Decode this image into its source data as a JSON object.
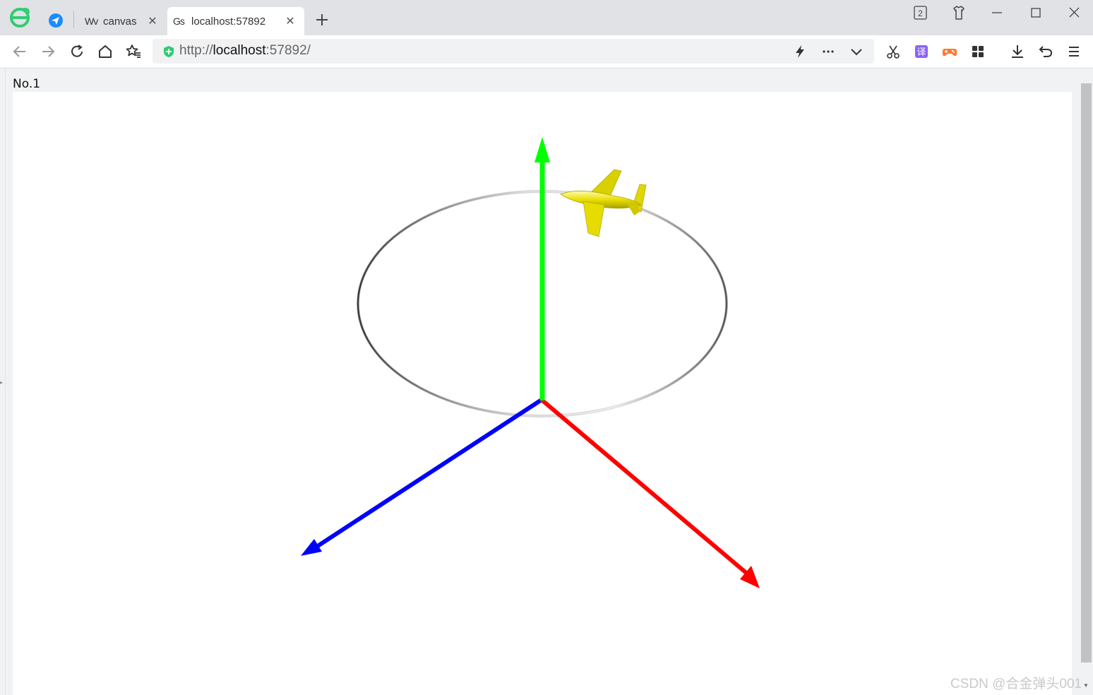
{
  "tabs": [
    {
      "favicon": "Wv",
      "label": "canvas",
      "active": false
    },
    {
      "favicon": "Gs",
      "label": "localhost:57892",
      "active": true
    }
  ],
  "window": {
    "tab_count": "2"
  },
  "address_bar": {
    "url_prefix": "http://",
    "url_host": "localhost",
    "url_suffix": ":57892/"
  },
  "extensions": {
    "translate_label": "译"
  },
  "page": {
    "label": "No.1",
    "watermark": "CSDN @合金弹头001"
  },
  "scene": {
    "objects": [
      "green-y-axis-arrow",
      "red-x-axis-arrow",
      "blue-z-axis-arrow",
      "circular-flight-path",
      "yellow-airplane"
    ],
    "colors": {
      "x_axis": "#ff0000",
      "y_axis": "#00ff00",
      "z_axis": "#0000ff",
      "airplane": "#e6dc00",
      "ring": "#8a8a8a"
    }
  }
}
